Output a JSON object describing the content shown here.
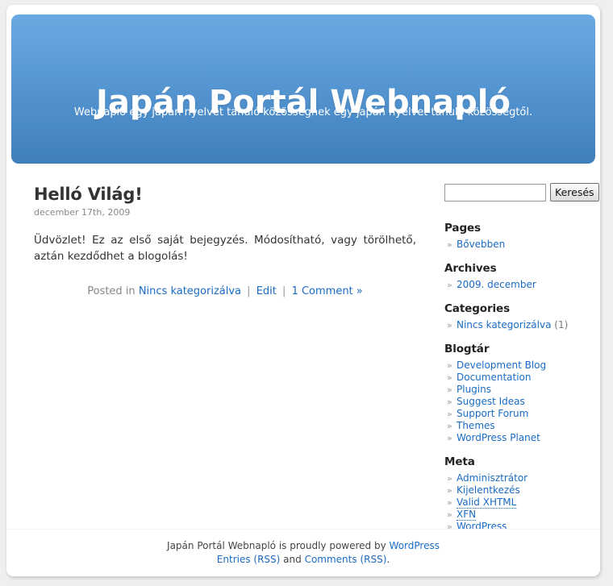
{
  "site": {
    "title": "Japán Portál Webnapló",
    "description": "Webnapló egy japán nyelvet tanuló közösségnek egy japán nyelvet tanuló közösségtől."
  },
  "post": {
    "title": "Helló Világ!",
    "date": "december 17th, 2009",
    "body": "Üdvözlet! Ez az első saját bejegyzés. Módosítható, vagy törölhető, aztán kezdődhet a blogolás!",
    "meta_prefix": "Posted in",
    "category_link": "Nincs kategorizálva",
    "edit_link": "Edit",
    "comments_link": "1 Comment »",
    "separator": "|"
  },
  "search": {
    "value": "",
    "placeholder": "",
    "button_label": "Keresés"
  },
  "sidebar": {
    "bullet": "»",
    "widgets": [
      {
        "title": "Pages",
        "items": [
          {
            "label": "Bővebben",
            "count": "",
            "abbr": false
          }
        ]
      },
      {
        "title": "Archives",
        "items": [
          {
            "label": "2009. december",
            "count": "",
            "abbr": false
          }
        ]
      },
      {
        "title": "Categories",
        "items": [
          {
            "label": "Nincs kategorizálva",
            "count": "(1)",
            "abbr": false
          }
        ]
      },
      {
        "title": "Blogtár",
        "items": [
          {
            "label": "Development Blog",
            "count": "",
            "abbr": false
          },
          {
            "label": "Documentation",
            "count": "",
            "abbr": false
          },
          {
            "label": "Plugins",
            "count": "",
            "abbr": false
          },
          {
            "label": "Suggest Ideas",
            "count": "",
            "abbr": false
          },
          {
            "label": "Support Forum",
            "count": "",
            "abbr": false
          },
          {
            "label": "Themes",
            "count": "",
            "abbr": false
          },
          {
            "label": "WordPress Planet",
            "count": "",
            "abbr": false
          }
        ]
      },
      {
        "title": "Meta",
        "items": [
          {
            "label": "Adminisztrátor",
            "count": "",
            "abbr": false
          },
          {
            "label": "Kijelentkezés",
            "count": "",
            "abbr": false
          },
          {
            "label": "Valid XHTML",
            "count": "",
            "abbr": true
          },
          {
            "label": "XFN",
            "count": "",
            "abbr": true
          },
          {
            "label": "WordPress",
            "count": "",
            "abbr": false
          }
        ]
      }
    ]
  },
  "footer": {
    "prefix": "Japán Portál Webnapló is proudly powered by",
    "wordpress_link": "WordPress",
    "entries_link": "Entries (RSS)",
    "and_text": "and",
    "comments_link": "Comments (RSS)",
    "trailing": "."
  },
  "colors": {
    "header_top": "#6aa9e2",
    "header_bottom": "#3f80bb",
    "link": "#1a6bc4",
    "page_bg": "#efefef",
    "body_text": "#333333"
  }
}
